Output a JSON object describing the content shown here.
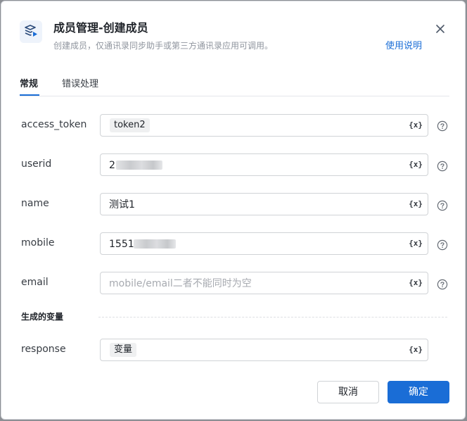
{
  "dialog": {
    "title": "成员管理-创建成员",
    "subtitle": "创建成员，仅通讯录同步助手或第三方通讯录应用可调用。",
    "help_link": "使用说明"
  },
  "tabs": [
    {
      "label": "常规",
      "active": true
    },
    {
      "label": "错误处理",
      "active": false
    }
  ],
  "fields": {
    "access_token": {
      "label": "access_token",
      "chip": "token2"
    },
    "userid": {
      "label": "userid",
      "value": "2"
    },
    "name": {
      "label": "name",
      "value": "测试1"
    },
    "mobile": {
      "label": "mobile",
      "value": "1551"
    },
    "email": {
      "label": "email",
      "placeholder": "mobile/email二者不能同时为空"
    }
  },
  "variable_icon_text": "{x}",
  "output_section": {
    "title": "生成的变量",
    "response": {
      "label": "response",
      "chip": "变量"
    }
  },
  "buttons": {
    "cancel": "取消",
    "ok": "确定"
  },
  "colors": {
    "accent": "#1a6dd6",
    "text": "#1f2329",
    "muted": "#8f959e"
  },
  "icons": [
    "app-logo-icon",
    "close-icon",
    "variable-icon",
    "help-circle-icon"
  ]
}
